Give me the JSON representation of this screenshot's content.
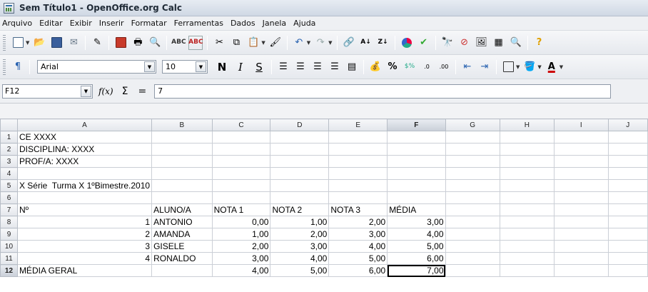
{
  "window": {
    "title": "Sem Título1 - OpenOffice.org Calc"
  },
  "menu": [
    "Arquivo",
    "Editar",
    "Exibir",
    "Inserir",
    "Formatar",
    "Ferramentas",
    "Dados",
    "Janela",
    "Ajuda"
  ],
  "toolbar_standard": {
    "icons": [
      "new-icon",
      "open-icon",
      "save-icon",
      "email-icon",
      "edit-file-icon",
      "export-pdf-icon",
      "print-icon",
      "page-preview-icon",
      "spellcheck-icon",
      "autospellcheck-icon",
      "cut-icon",
      "copy-icon",
      "paste-icon",
      "clone-format-icon",
      "undo-icon",
      "redo-icon",
      "hyperlink-icon",
      "sort-ascending-icon",
      "sort-descending-icon",
      "chart-icon",
      "draw-functions-icon",
      "find-replace-icon",
      "navigator-icon",
      "gallery-icon",
      "data-sources-icon",
      "zoom-icon",
      "help-icon"
    ]
  },
  "toolbar_format": {
    "font_name": "Arial",
    "font_size": "10",
    "bold": "N",
    "italic": "I",
    "underline": "S",
    "percent": "%"
  },
  "formula_bar": {
    "cell_ref": "F12",
    "fx": "f(x)",
    "sigma": "Σ",
    "equals": "=",
    "content": "7"
  },
  "sheet": {
    "columns": [
      "A",
      "B",
      "C",
      "D",
      "E",
      "F",
      "G",
      "H",
      "I",
      "J"
    ],
    "active_column": "F",
    "active_row": "12",
    "rows": [
      {
        "n": "1",
        "A": "CE XXXX"
      },
      {
        "n": "2",
        "A": "DISCIPLINA: XXXX"
      },
      {
        "n": "3",
        "A": "PROF/A: XXXX"
      },
      {
        "n": "4"
      },
      {
        "n": "5",
        "A": "X Série  Turma X 1ºBimestre.2010"
      },
      {
        "n": "6"
      },
      {
        "n": "7",
        "A": "Nº",
        "B": "ALUNO/A",
        "C": "NOTA 1",
        "D": "NOTA 2",
        "E": "NOTA 3",
        "F": "MÉDIA"
      },
      {
        "n": "8",
        "A": "1",
        "B": "ANTONIO",
        "C": "0,00",
        "D": "1,00",
        "E": "2,00",
        "F": "3,00"
      },
      {
        "n": "9",
        "A": "2",
        "B": "AMANDA",
        "C": "1,00",
        "D": "2,00",
        "E": "3,00",
        "F": "4,00"
      },
      {
        "n": "10",
        "A": "3",
        "B": "GISELE",
        "C": "2,00",
        "D": "3,00",
        "E": "4,00",
        "F": "5,00"
      },
      {
        "n": "11",
        "A": "4",
        "B": "RONALDO",
        "C": "3,00",
        "D": "4,00",
        "E": "5,00",
        "F": "6,00"
      },
      {
        "n": "12",
        "A": "MÉDIA GERAL",
        "C": "4,00",
        "D": "5,00",
        "E": "6,00",
        "F": "7,00"
      }
    ]
  }
}
